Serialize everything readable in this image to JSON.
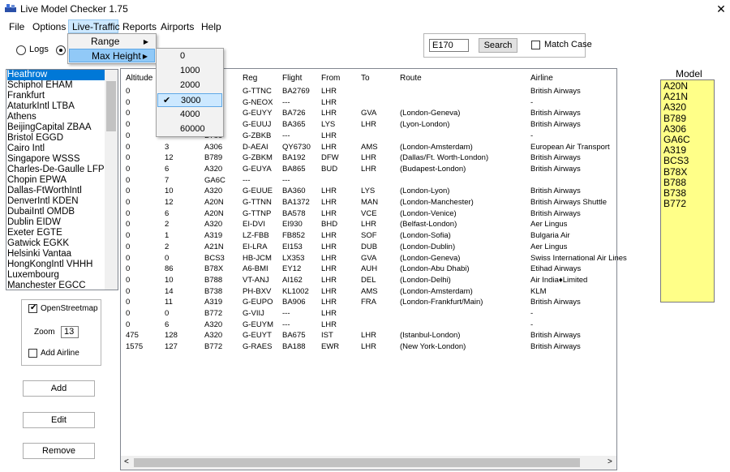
{
  "window": {
    "title": "Live Model Checker 1.75",
    "close_glyph": "✕"
  },
  "menu": [
    "File",
    "Options",
    "Live-Traffic",
    "Reports",
    "Airports",
    "Help"
  ],
  "live_traffic_menu": {
    "range": "Range",
    "max_height": "Max Height",
    "submenu_arrow": "▶"
  },
  "max_height_menu": {
    "options": [
      "0",
      "1000",
      "2000",
      "3000",
      "4000",
      "60000"
    ],
    "selected": "3000",
    "check_glyph": "✔"
  },
  "mode_radios": {
    "logs_label": "Logs",
    "live_selected": true
  },
  "search": {
    "value": "E170",
    "button": "Search",
    "match_case_label": "Match Case",
    "match_case_checked": false
  },
  "airports": [
    "Heathrow",
    "Schiphol EHAM",
    "Frankfurt",
    "AtaturkIntl LTBA",
    "Athens",
    "BeijingCapital ZBAA",
    "Bristol EGGD",
    "Cairo Intl",
    "Singapore WSSS",
    "Charles-De-Gaulle LFP",
    "Chopin EPWA",
    "Dallas-FtWorthIntl",
    "DenverIntl KDEN",
    "DubaiIntl OMDB",
    "Dublin EIDW",
    "Exeter EGTE",
    "Gatwick EGKK",
    "Helsinki Vantaa",
    "HongKongIntl VHHH",
    "Luxembourg",
    "Manchester EGCC"
  ],
  "selected_airport": "Heathrow",
  "map_options": {
    "openstreetmap_label": "OpenStreetmap",
    "openstreetmap_checked": true,
    "zoom_label": "Zoom",
    "zoom_value": "13",
    "add_airline_label": "Add Airline",
    "add_airline_checked": false
  },
  "buttons": {
    "add": "Add",
    "edit": "Edit",
    "remove": "Remove"
  },
  "table": {
    "columns": [
      "Altitude",
      "",
      "",
      "Reg",
      "Flight",
      "From",
      "To",
      "Route",
      "Airline"
    ],
    "rows": [
      [
        "0",
        "",
        "",
        "G-TTNC",
        "BA2769",
        "LHR",
        "",
        "",
        "British Airways"
      ],
      [
        "0",
        "",
        "",
        "G-NEOX",
        "---",
        "LHR",
        "",
        "",
        "-"
      ],
      [
        "0",
        "",
        "",
        "G-EUYY",
        "BA726",
        "LHR",
        "GVA",
        "(London-Geneva)",
        "British Airways"
      ],
      [
        "0",
        "",
        "",
        "G-EUUJ",
        "BA365",
        "LYS",
        "LHR",
        "(Lyon-London)",
        "British Airways"
      ],
      [
        "0",
        "",
        "B788",
        "G-ZBKB",
        "---",
        "LHR",
        "",
        "",
        "-"
      ],
      [
        "0",
        "3",
        "A306",
        "D-AEAI",
        "QY6730",
        "LHR",
        "AMS",
        "(London-Amsterdam)",
        "European Air Transport"
      ],
      [
        "0",
        "12",
        "B789",
        "G-ZBKM",
        "BA192",
        "DFW",
        "LHR",
        "(Dallas/Ft. Worth-London)",
        "British Airways"
      ],
      [
        "0",
        "6",
        "A320",
        "G-EUYA",
        "BA865",
        "BUD",
        "LHR",
        "(Budapest-London)",
        "British Airways"
      ],
      [
        "0",
        "7",
        "GA6C",
        "---",
        "---",
        "",
        "",
        "",
        ""
      ],
      [
        "0",
        "10",
        "A320",
        "G-EUUE",
        "BA360",
        "LHR",
        "LYS",
        "(London-Lyon)",
        "British Airways"
      ],
      [
        "0",
        "12",
        "A20N",
        "G-TTNN",
        "BA1372",
        "LHR",
        "MAN",
        "(London-Manchester)",
        "British Airways Shuttle"
      ],
      [
        "0",
        "6",
        "A20N",
        "G-TTNP",
        "BA578",
        "LHR",
        "VCE",
        "(London-Venice)",
        "British Airways"
      ],
      [
        "0",
        "2",
        "A320",
        "EI-DVI",
        "EI930",
        "BHD",
        "LHR",
        "(Belfast-London)",
        "Aer Lingus"
      ],
      [
        "0",
        "1",
        "A319",
        "LZ-FBB",
        "FB852",
        "LHR",
        "SOF",
        "(London-Sofia)",
        "Bulgaria Air"
      ],
      [
        "0",
        "2",
        "A21N",
        "EI-LRA",
        "EI153",
        "LHR",
        "DUB",
        "(London-Dublin)",
        "Aer Lingus"
      ],
      [
        "0",
        "0",
        "BCS3",
        "HB-JCM",
        "LX353",
        "LHR",
        "GVA",
        "(London-Geneva)",
        "Swiss International Air Lines"
      ],
      [
        "0",
        "86",
        "B78X",
        "A6-BMI",
        "EY12",
        "LHR",
        "AUH",
        "(London-Abu Dhabi)",
        "Etihad Airways"
      ],
      [
        "0",
        "10",
        "B788",
        "VT-ANJ",
        "AI162",
        "LHR",
        "DEL",
        "(London-Delhi)",
        "Air India♦Limited"
      ],
      [
        "0",
        "14",
        "B738",
        "PH-BXV",
        "KL1002",
        "LHR",
        "AMS",
        "(London-Amsterdam)",
        "KLM"
      ],
      [
        "0",
        "11",
        "A319",
        "G-EUPO",
        "BA906",
        "LHR",
        "FRA",
        "(London-Frankfurt/Main)",
        "British Airways"
      ],
      [
        "0",
        "0",
        "B772",
        "G-VIIJ",
        "---",
        "LHR",
        "",
        "",
        "-"
      ],
      [
        "0",
        "6",
        "A320",
        "G-EUYM",
        "---",
        "LHR",
        "",
        "",
        "-"
      ],
      [
        "475",
        "128",
        "A320",
        "G-EUYT",
        "BA675",
        "IST",
        "LHR",
        "(Istanbul-London)",
        "British Airways"
      ],
      [
        "1575",
        "127",
        "B772",
        "G-RAES",
        "BA188",
        "EWR",
        "LHR",
        "(New York-London)",
        "British Airways"
      ]
    ]
  },
  "scroll_glyphs": {
    "left": "<",
    "right": ">"
  },
  "model": {
    "label": "Model",
    "items": [
      "A20N",
      "A21N",
      "A320",
      "B789",
      "A306",
      "GA6C",
      "A319",
      "BCS3",
      "B78X",
      "B788",
      "B738",
      "B772"
    ]
  }
}
